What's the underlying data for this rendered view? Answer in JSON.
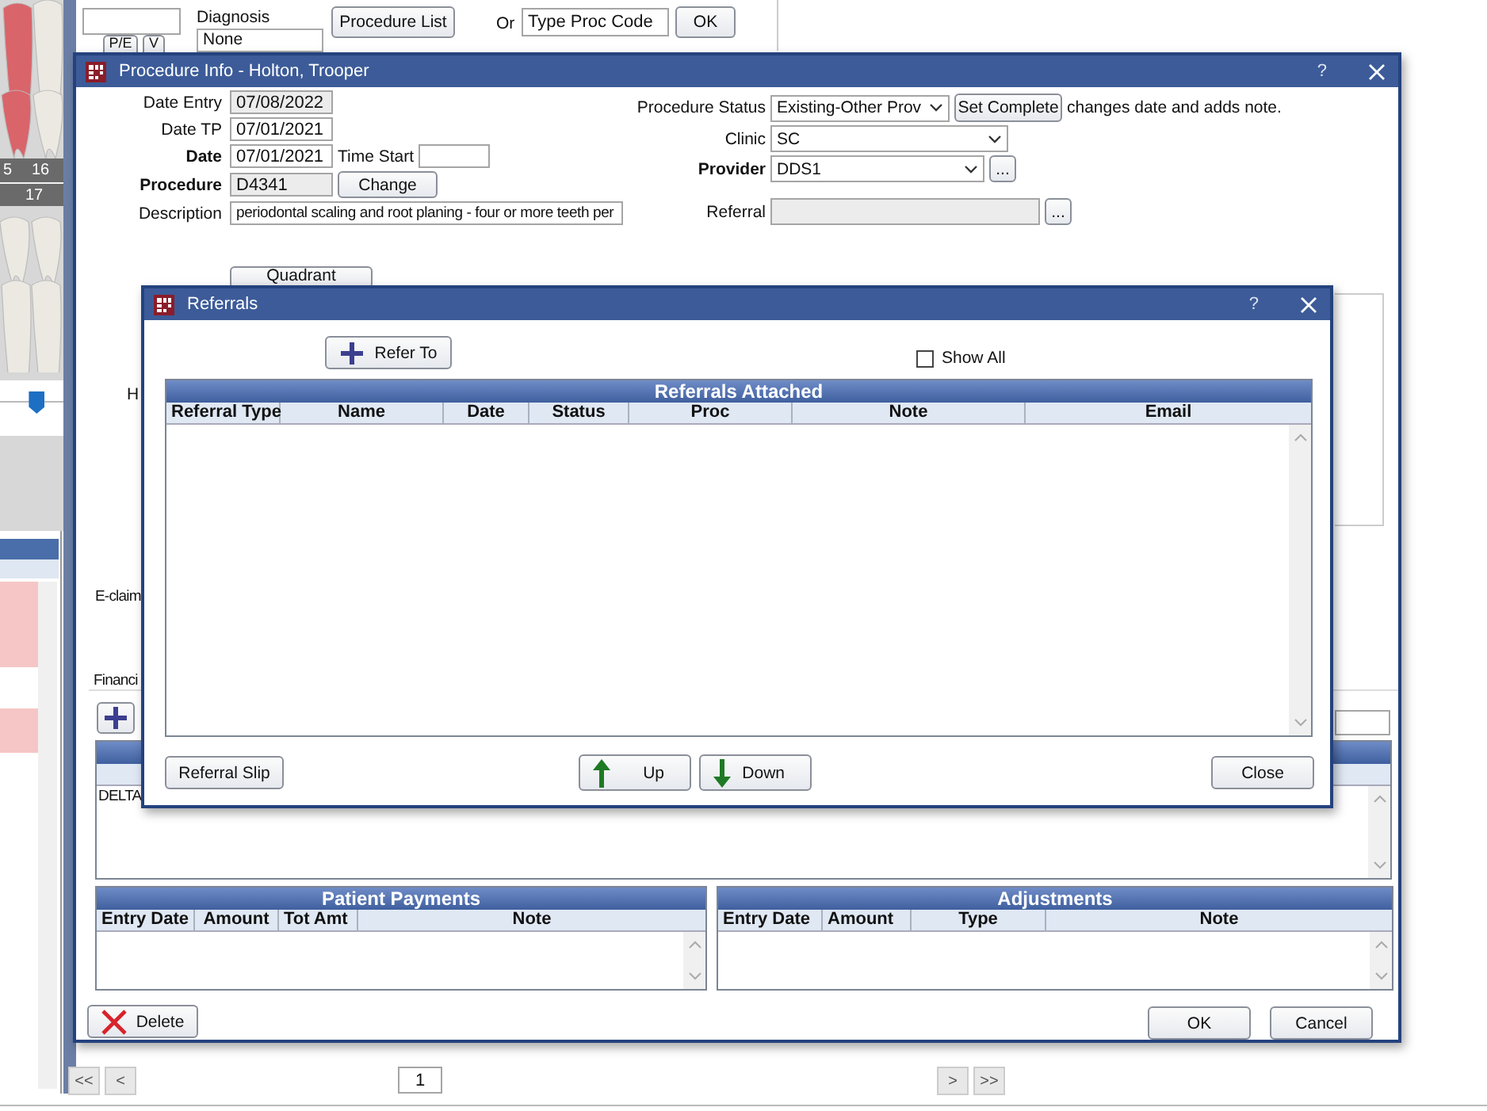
{
  "background": {
    "tooth_numbers": [
      "5",
      "16",
      "17"
    ],
    "zoom_slider": {
      "level": 0.58
    },
    "diagnosis": {
      "label": "Diagnosis",
      "value": "None"
    },
    "small_buttons": [
      "P/E",
      "V"
    ],
    "procedure_list_button": "Procedure List",
    "or_label": "Or",
    "proc_code_field": {
      "value": "Type Proc Code"
    },
    "ok_button": "OK",
    "pager": {
      "first": "<<",
      "prev": "<",
      "page": "1",
      "next": ">",
      "last": ">>"
    }
  },
  "procedure_window": {
    "title": "Procedure Info - Holton, Trooper",
    "help": "?",
    "fields": [
      {
        "label": "Date Entry",
        "value": "07/08/2022",
        "bold": false,
        "readonly": true
      },
      {
        "label": "Date TP",
        "value": "07/01/2021",
        "bold": false,
        "readonly": false
      },
      {
        "label": "Date",
        "value": "07/01/2021",
        "bold": true,
        "readonly": false
      },
      {
        "label": "Procedure",
        "value": "D4341",
        "bold": true,
        "readonly": true
      },
      {
        "label": "Description",
        "value": "periodontal scaling and root planing - four or more teeth per",
        "bold": false,
        "readonly": false
      }
    ],
    "time_start_label": "Time Start",
    "change_button": "Change",
    "status": {
      "label": "Procedure Status",
      "value": "Existing-Other Prov",
      "button": "Set Complete",
      "note": "changes date and adds note."
    },
    "clinic": {
      "label": "Clinic",
      "value": "SC"
    },
    "provider": {
      "label": "Provider",
      "value": "DDS1",
      "button": "..."
    },
    "referral": {
      "label": "Referral",
      "button": "..."
    },
    "quadrant_button": "Quadrant",
    "h_label": "H",
    "eclaim_label": "E-claim",
    "financial_label": "Financi",
    "claim_row": "DELTA",
    "patient_payments": {
      "title": "Patient Payments",
      "columns": [
        "Entry Date",
        "Amount",
        "Tot Amt",
        "Note"
      ]
    },
    "adjustments": {
      "title": "Adjustments",
      "columns": [
        "Entry Date",
        "Amount",
        "Type",
        "Note"
      ]
    },
    "buttons": {
      "delete": "Delete",
      "ok": "OK",
      "cancel": "Cancel"
    }
  },
  "referrals_dialog": {
    "title": "Referrals",
    "help": "?",
    "refer_to_button": "Refer To",
    "show_all": {
      "label": "Show All",
      "checked": false
    },
    "grid": {
      "title": "Referrals Attached",
      "columns": [
        "Referral Type",
        "Name",
        "Date",
        "Status",
        "Proc",
        "Note",
        "Email"
      ]
    },
    "buttons": {
      "slip": "Referral Slip",
      "up": "Up",
      "down": "Down",
      "close": "Close"
    }
  }
}
